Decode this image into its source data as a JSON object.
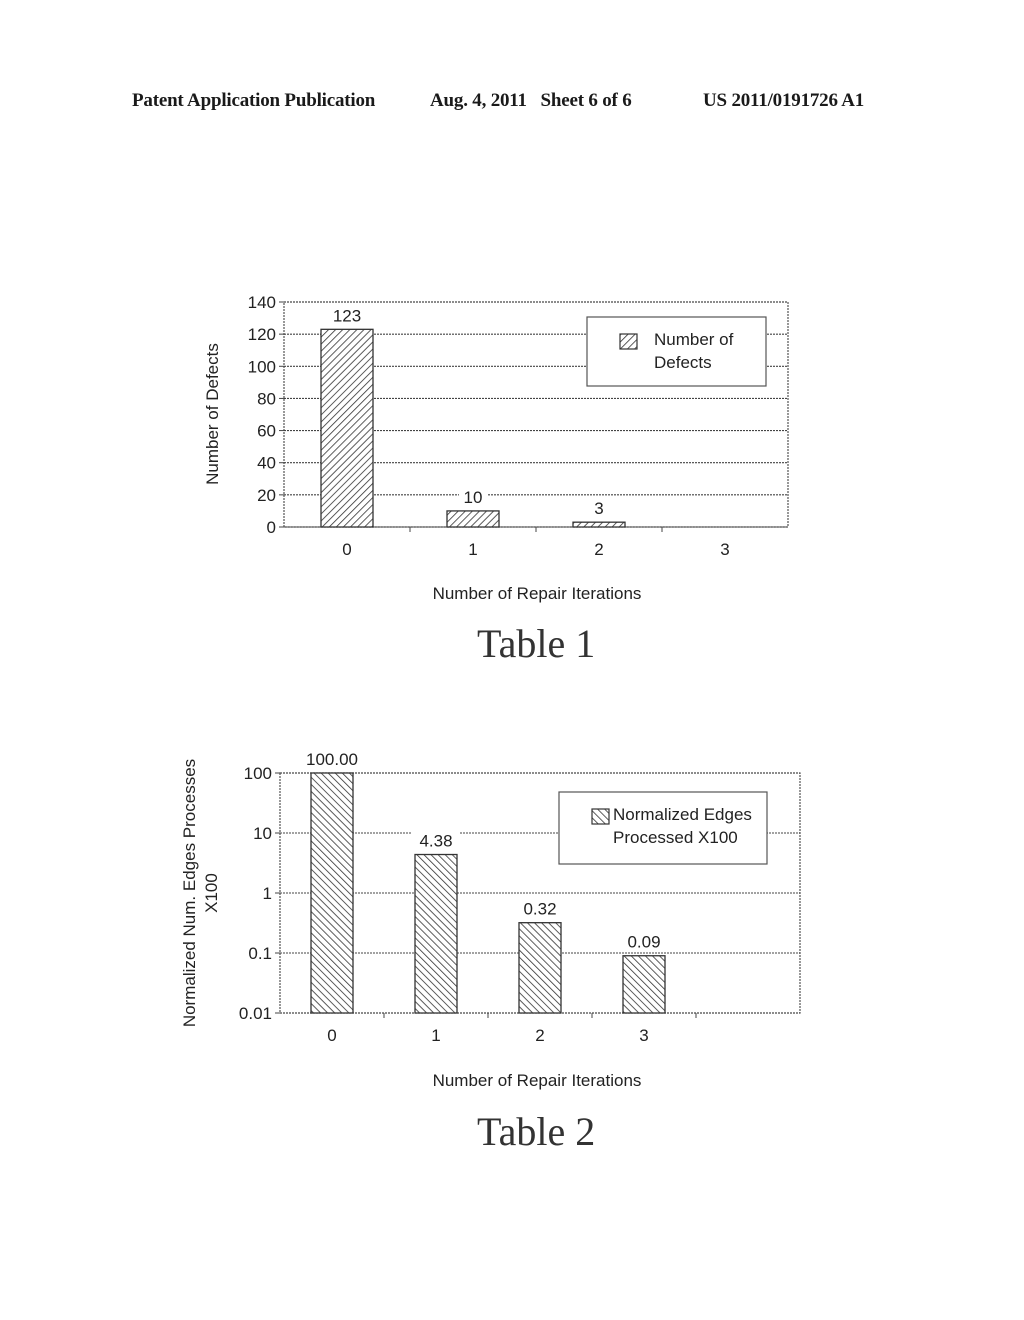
{
  "header": {
    "left": "Patent Application Publication",
    "middle": "Aug. 4, 2011   Sheet 6 of 6",
    "right": "US 2011/0191726 A1"
  },
  "chart_data": [
    {
      "type": "bar",
      "caption": "Table 1",
      "title": "",
      "categories": [
        "0",
        "1",
        "2",
        "3"
      ],
      "series": [
        {
          "name": "Number of Defects",
          "values": [
            123,
            10,
            3,
            null
          ]
        }
      ],
      "data_labels": [
        "123",
        "10",
        "3",
        ""
      ],
      "xlabel": "Number of Repair Iterations",
      "ylabel": "Number of Defects",
      "ylim": [
        0,
        140
      ],
      "yticks": [
        0,
        20,
        40,
        60,
        80,
        100,
        120,
        140
      ],
      "ytick_labels": [
        "0",
        "20",
        "40",
        "60",
        "80",
        "100",
        "120",
        "140"
      ],
      "yscale": "linear",
      "grid": true,
      "legend": {
        "placement": "top-right",
        "lines": [
          "Number of",
          "Defects"
        ],
        "pattern": "hatch-forward"
      }
    },
    {
      "type": "bar",
      "caption": "Table 2",
      "title": "",
      "categories": [
        "0",
        "1",
        "2",
        "3"
      ],
      "series": [
        {
          "name": "Normalized Edges Processed X100",
          "values": [
            100.0,
            4.38,
            0.32,
            0.09
          ]
        }
      ],
      "data_labels": [
        "100.00",
        "4.38",
        "0.32",
        "0.09"
      ],
      "xlabel": "Number of Repair Iterations",
      "ylabel": [
        "Normalized Num. Edges Processes",
        "X100"
      ],
      "ylim": [
        0.01,
        100
      ],
      "yticks": [
        0.01,
        0.1,
        1,
        10,
        100
      ],
      "ytick_labels": [
        "0.01",
        "0.1",
        "1",
        "10",
        "100"
      ],
      "yscale": "log",
      "grid": true,
      "legend": {
        "placement": "top-right",
        "lines": [
          "Normalized Edges",
          "Processed X100"
        ],
        "pattern": "hatch-backward"
      }
    }
  ]
}
